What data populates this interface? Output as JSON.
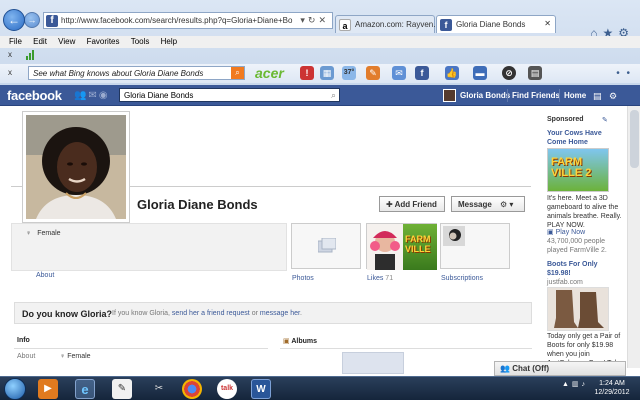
{
  "browser": {
    "address_url": "http://www.facebook.com/search/results.php?q=Gloria+Diane+Bo",
    "tabs": [
      {
        "label": "Amazon.com: Rayven...",
        "icon": "a"
      },
      {
        "label": "Gloria Diane Bonds",
        "icon": "f"
      }
    ],
    "menu": [
      "File",
      "Edit",
      "View",
      "Favorites",
      "Tools",
      "Help"
    ],
    "bing_placeholder": "See what Bing knows about Gloria Diane Bonds",
    "acer_logo": "acer",
    "weather": "37°"
  },
  "fb_bar": {
    "logo": "facebook",
    "search_value": "Gloria Diane Bonds",
    "user_name": "Gloria Bonds",
    "find_friends": "Find Friends",
    "home": "Home"
  },
  "profile": {
    "name": "Gloria Diane Bonds",
    "add_friend": "Add Friend",
    "message": "Message",
    "gender": "Female",
    "about": "About"
  },
  "thumbs": {
    "photos": "Photos",
    "likes": "Likes",
    "likes_count": "71",
    "subscriptions": "Subscriptions",
    "farmville_label": "FARM VILLE"
  },
  "know": {
    "title": "Do you know Gloria?",
    "prefix": "If you know Gloria,",
    "link1": "send her a friend request",
    "middle": "or",
    "link2": "message her",
    "suffix": "."
  },
  "sections": {
    "info": "Info",
    "albums": "Albums",
    "about_label": "About",
    "about_value": "Female"
  },
  "sidebar": {
    "sponsored": "Sponsored",
    "ad1": {
      "title": "Your Cows Have Come Home",
      "image_text": "FARM VILLE 2",
      "body": "It's here. Meet a 3D gameboard to alive the animals breathe. Really. PLAY NOW.",
      "cta": "Play Now",
      "stats": "43,700,000 people played FarmVille 2."
    },
    "ad2": {
      "title": "Boots For Only $19.98!",
      "domain": "justfab.com",
      "body": "Today only get a Pair of Boots for only $19.98 when you join JustFab.com Free! Take"
    }
  },
  "chat": {
    "label": "Chat (Off)"
  },
  "taskbar": {
    "time": "1:24 AM",
    "date": "12/29/2012",
    "talk": "talk",
    "word": "W"
  }
}
